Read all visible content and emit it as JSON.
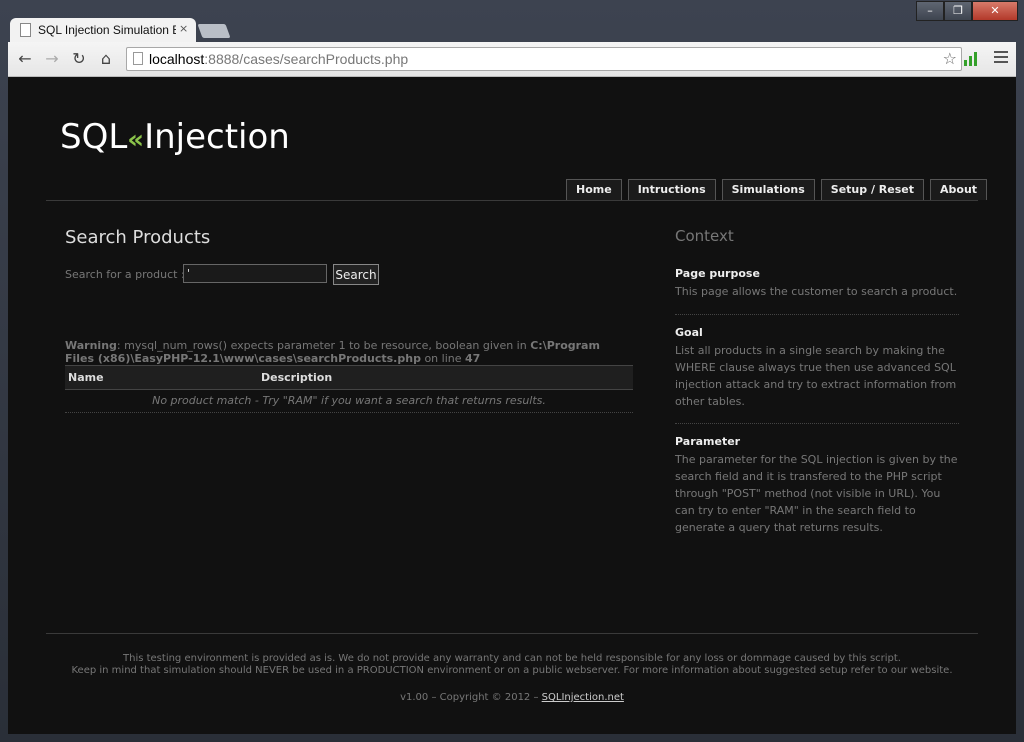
{
  "browser": {
    "tab_title": "SQL Injection Simulation E",
    "tab_close": "×",
    "url_host": "localhost",
    "url_rest": ":8888/cases/searchProducts.php",
    "win_min": "–",
    "win_max": "❐",
    "win_close": "✕",
    "back": "←",
    "forward": "→",
    "reload": "↻",
    "home": "⌂",
    "star": "☆"
  },
  "site": {
    "logo_left": "SQL",
    "logo_arrows": "«",
    "logo_right": "Injection",
    "nav": [
      "Home",
      "Intructions",
      "Simulations",
      "Setup / Reset",
      "About"
    ]
  },
  "main": {
    "title": "Search Products",
    "search_label": "Search for a product :",
    "search_value": "'",
    "search_button": "Search",
    "warning_label": "Warning",
    "warning_text": ": mysql_num_rows() expects parameter 1 to be resource, boolean given in ",
    "warning_path": "C:\\Program Files (x86)\\EasyPHP-12.1\\www\\cases\\searchProducts.php",
    "warning_line_text": " on line ",
    "warning_line": "47",
    "table_headers": [
      "Name",
      "Description"
    ],
    "no_match": "No product match - Try \"RAM\" if you want a search that returns results."
  },
  "context": {
    "title": "Context",
    "blocks": [
      {
        "heading": "Page purpose",
        "text": "This page allows the customer to search a product."
      },
      {
        "heading": "Goal",
        "text": "List all products in a single search by making the WHERE clause always true then use advanced SQL injection attack and try to extract information from other tables."
      },
      {
        "heading": "Parameter",
        "text": "The parameter for the SQL injection is given by the search field and it is transfered to the PHP script through \"POST\" method (not visible in URL). You can try to enter \"RAM\" in the search field to generate a query that returns results."
      }
    ]
  },
  "footer": {
    "line1": "This testing environment is provided as is. We do not provide any warranty and can not be held responsible for any loss or dommage caused by this script.",
    "line2": "Keep in mind that simulation should NEVER be used in a PRODUCTION environment or on a public webserver. For more information about suggested setup refer to our website.",
    "version": "v1.00 – Copyright © 2012 – ",
    "link": "SQLInjection.net"
  }
}
